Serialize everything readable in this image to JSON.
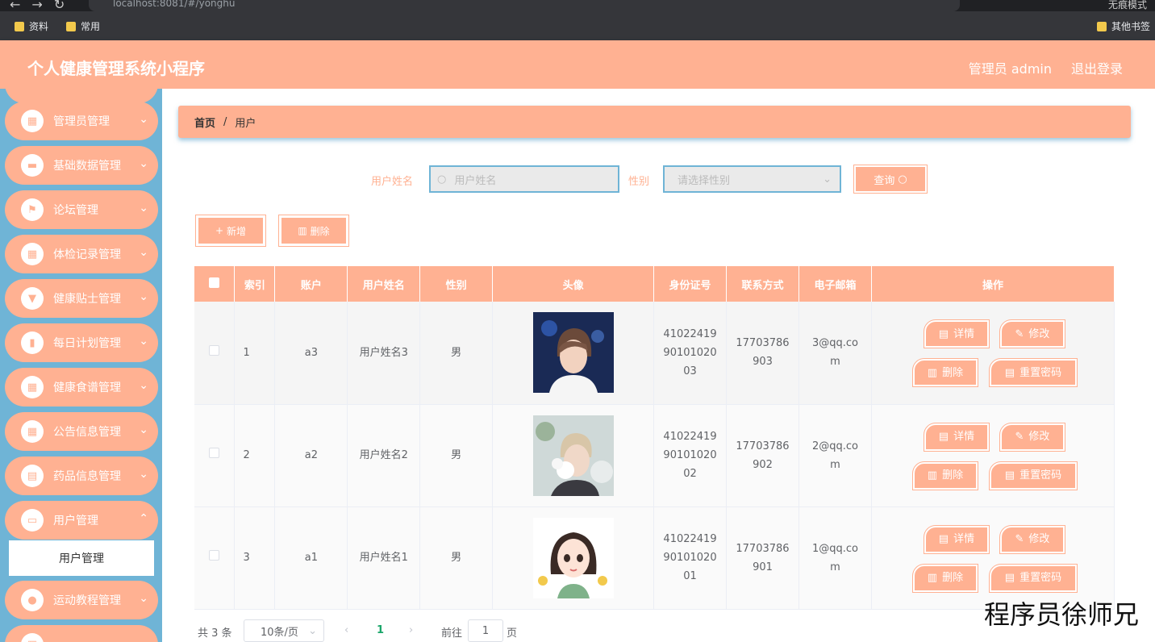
{
  "browser": {
    "url": "localhost:8081/#/yonghu",
    "incognito": "无痕模式",
    "bookmarks": [
      "资料",
      "常用"
    ],
    "other_bookmarks": "其他书签"
  },
  "header": {
    "title": "个人健康管理系统小程序",
    "admin": "管理员 admin",
    "logout": "退出登录",
    "color": "#ffb192"
  },
  "sidebar": {
    "items": [
      {
        "label": "管理员管理",
        "icon": "grid-icon"
      },
      {
        "label": "基础数据管理",
        "icon": "chat-icon"
      },
      {
        "label": "论坛管理",
        "icon": "flag-icon"
      },
      {
        "label": "体检记录管理",
        "icon": "grid-icon"
      },
      {
        "label": "健康贴士管理",
        "icon": "sign-icon"
      },
      {
        "label": "每日计划管理",
        "icon": "chart-icon"
      },
      {
        "label": "健康食谱管理",
        "icon": "grid-icon"
      },
      {
        "label": "公告信息管理",
        "icon": "apps-icon"
      },
      {
        "label": "药品信息管理",
        "icon": "clipboard-icon"
      },
      {
        "label": "用户管理",
        "icon": "briefcase-icon"
      },
      {
        "label": "运动教程管理",
        "icon": "user-icon"
      }
    ],
    "active_sub": "用户管理",
    "color": "#6fb4d6"
  },
  "breadcrumb": {
    "home": "首页",
    "sep": "/",
    "current": "用户"
  },
  "search": {
    "name_label": "用户姓名",
    "name_placeholder": "用户姓名",
    "gender_label": "性别",
    "gender_placeholder": "请选择性别",
    "query": "查询"
  },
  "actions": {
    "add": "新增",
    "delete": "删除"
  },
  "table": {
    "headers": [
      "索引",
      "账户",
      "用户姓名",
      "性别",
      "头像",
      "身份证号",
      "联系方式",
      "电子邮箱",
      "操作"
    ],
    "rows": [
      {
        "index": "1",
        "account": "a3",
        "name": "用户姓名3",
        "gender": "男",
        "id_lines": [
          "41022419",
          "90101020",
          "03"
        ],
        "phone_lines": [
          "17703786",
          "903"
        ],
        "email_lines": [
          "3@qq.co",
          "m"
        ]
      },
      {
        "index": "2",
        "account": "a2",
        "name": "用户姓名2",
        "gender": "男",
        "id_lines": [
          "41022419",
          "90101020",
          "02"
        ],
        "phone_lines": [
          "17703786",
          "902"
        ],
        "email_lines": [
          "2@qq.co",
          "m"
        ]
      },
      {
        "index": "3",
        "account": "a1",
        "name": "用户姓名1",
        "gender": "男",
        "id_lines": [
          "41022419",
          "90101020",
          "01"
        ],
        "phone_lines": [
          "17703786",
          "901"
        ],
        "email_lines": [
          "1@qq.co",
          "m"
        ]
      }
    ],
    "ops": {
      "detail": "详情",
      "edit": "修改",
      "delete": "删除",
      "reset": "重置密码"
    }
  },
  "pagination": {
    "total": "共 3 条",
    "page_size": "10条/页",
    "current": "1",
    "goto_label": "前往",
    "goto_value": "1",
    "page_unit": "页",
    "prev": "‹",
    "next": "›"
  },
  "watermark": "程序员徐师兄"
}
